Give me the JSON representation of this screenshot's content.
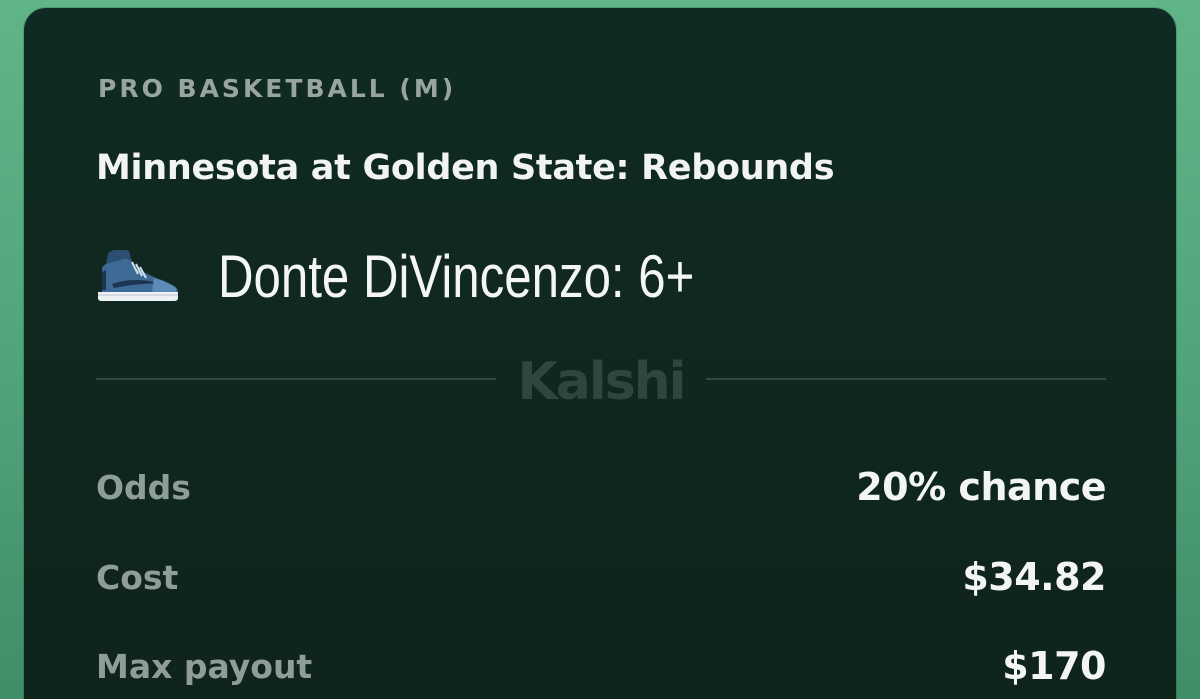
{
  "card": {
    "category": "PRO BASKETBALL (M)",
    "market_title": "Minnesota at Golden State: Rebounds",
    "outcome": {
      "icon": "sneaker-icon",
      "label": "Donte DiVincenzo: 6+"
    },
    "brand": "Kalshi",
    "details": [
      {
        "label": "Odds",
        "value": "20% chance"
      },
      {
        "label": "Cost",
        "value": "$34.82"
      },
      {
        "label": "Max payout",
        "value": "$170"
      }
    ]
  },
  "colors": {
    "background_green": "#4fa37a",
    "card_dark_green": "#10281f",
    "text_primary": "#f3f5f4",
    "text_muted": "#8f9d97",
    "brand_watermark": "#2f463c"
  }
}
